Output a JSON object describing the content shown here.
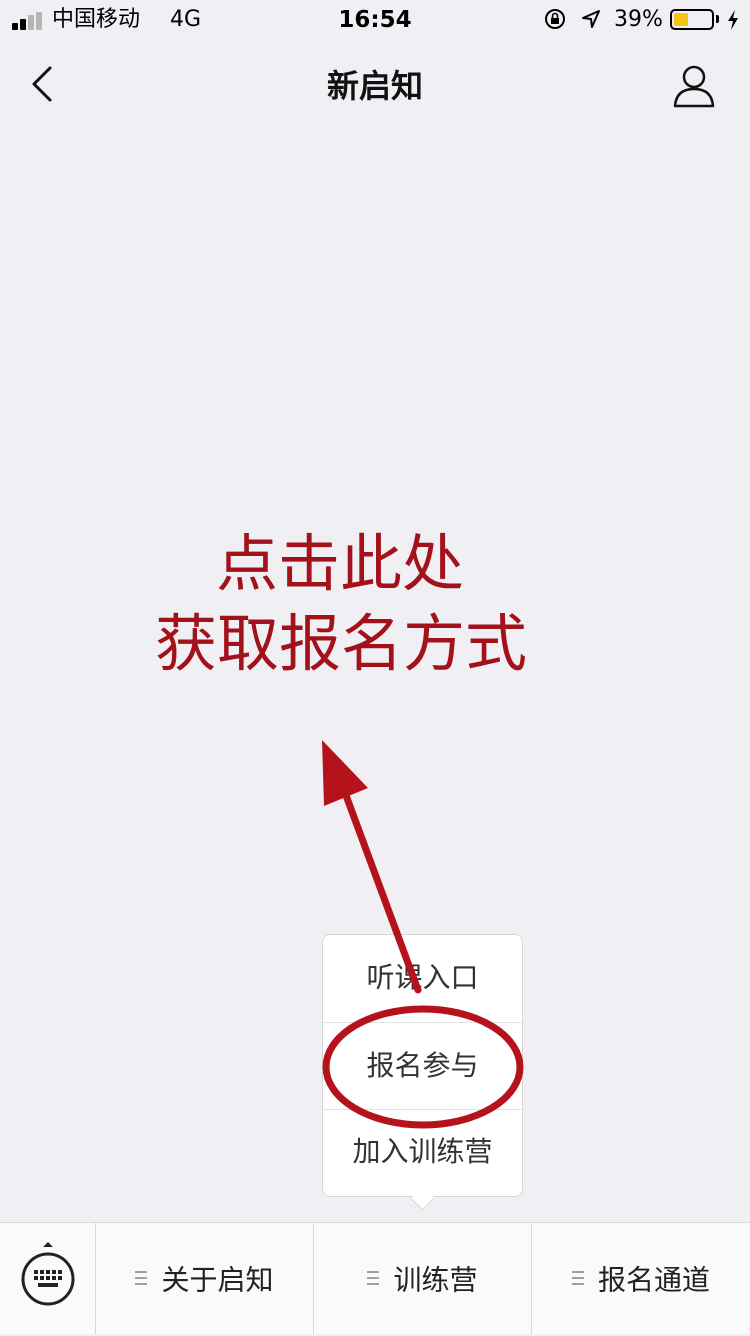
{
  "status_bar": {
    "carrier": "中国移动",
    "network": "4G",
    "time": "16:54",
    "battery_percent": "39%",
    "battery_level": 0.39,
    "battery_color": "#f5c414",
    "icons": [
      "signal-icon",
      "rotation-lock-icon",
      "location-arrow-icon",
      "battery-icon",
      "charging-bolt-icon"
    ]
  },
  "nav": {
    "title": "新启知",
    "back_icon": "chevron-left-icon",
    "profile_icon": "user-profile-icon"
  },
  "annotation": {
    "line1": "点击此处",
    "line2": "获取报名方式",
    "color": "#a3121a"
  },
  "popup_menu": {
    "items": [
      "听课入口",
      "报名参与",
      "加入训练营"
    ]
  },
  "bottom_menu": {
    "keyboard_icon": "keyboard-icon",
    "tabs": [
      "关于启知",
      "训练营",
      "报名通道"
    ]
  }
}
